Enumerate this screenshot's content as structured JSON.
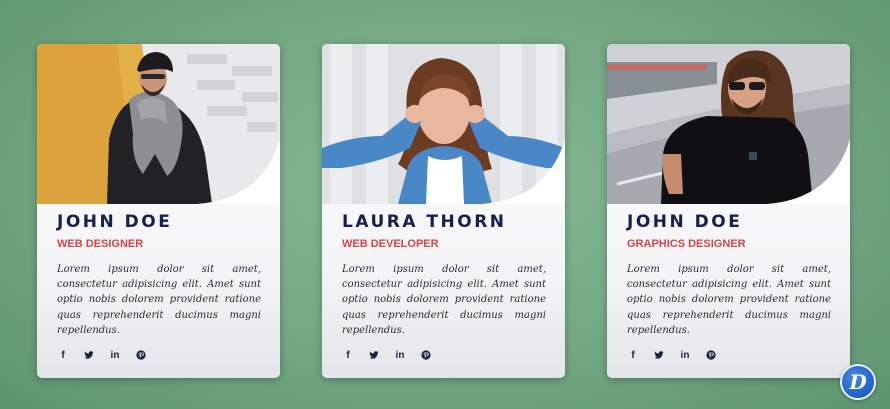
{
  "cards": [
    {
      "name": "JOHN DOE",
      "role": "WEB DESIGNER",
      "description": "Lorem ipsum dolor sit amet, consectetur adipisicing elit. Amet sunt optio nobis dolorem provident ratione quas reprehenderit ducimus magni repellendus."
    },
    {
      "name": "LAURA THORN",
      "role": "WEB DEVELOPER",
      "description": "Lorem ipsum dolor sit amet, consectetur adipisicing elit. Amet sunt optio nobis dolorem provident ratione quas reprehenderit ducimus magni repellendus."
    },
    {
      "name": "JOHN DOE",
      "role": "GRAPHICS DESIGNER",
      "description": "Lorem ipsum dolor sit amet, consectetur adipisicing elit. Amet sunt optio nobis dolorem provident ratione quas reprehenderit ducimus magni repellendus."
    }
  ],
  "social_icons": [
    "facebook-icon",
    "twitter-icon",
    "linkedin-icon",
    "pinterest-icon"
  ],
  "social_glyphs": {
    "facebook": "f",
    "linkedin": "in"
  },
  "watermark_letter": "D",
  "colors": {
    "background": "#73a882",
    "name": "#16204a",
    "role": "#d24545",
    "watermark": "#1e5fc2"
  }
}
